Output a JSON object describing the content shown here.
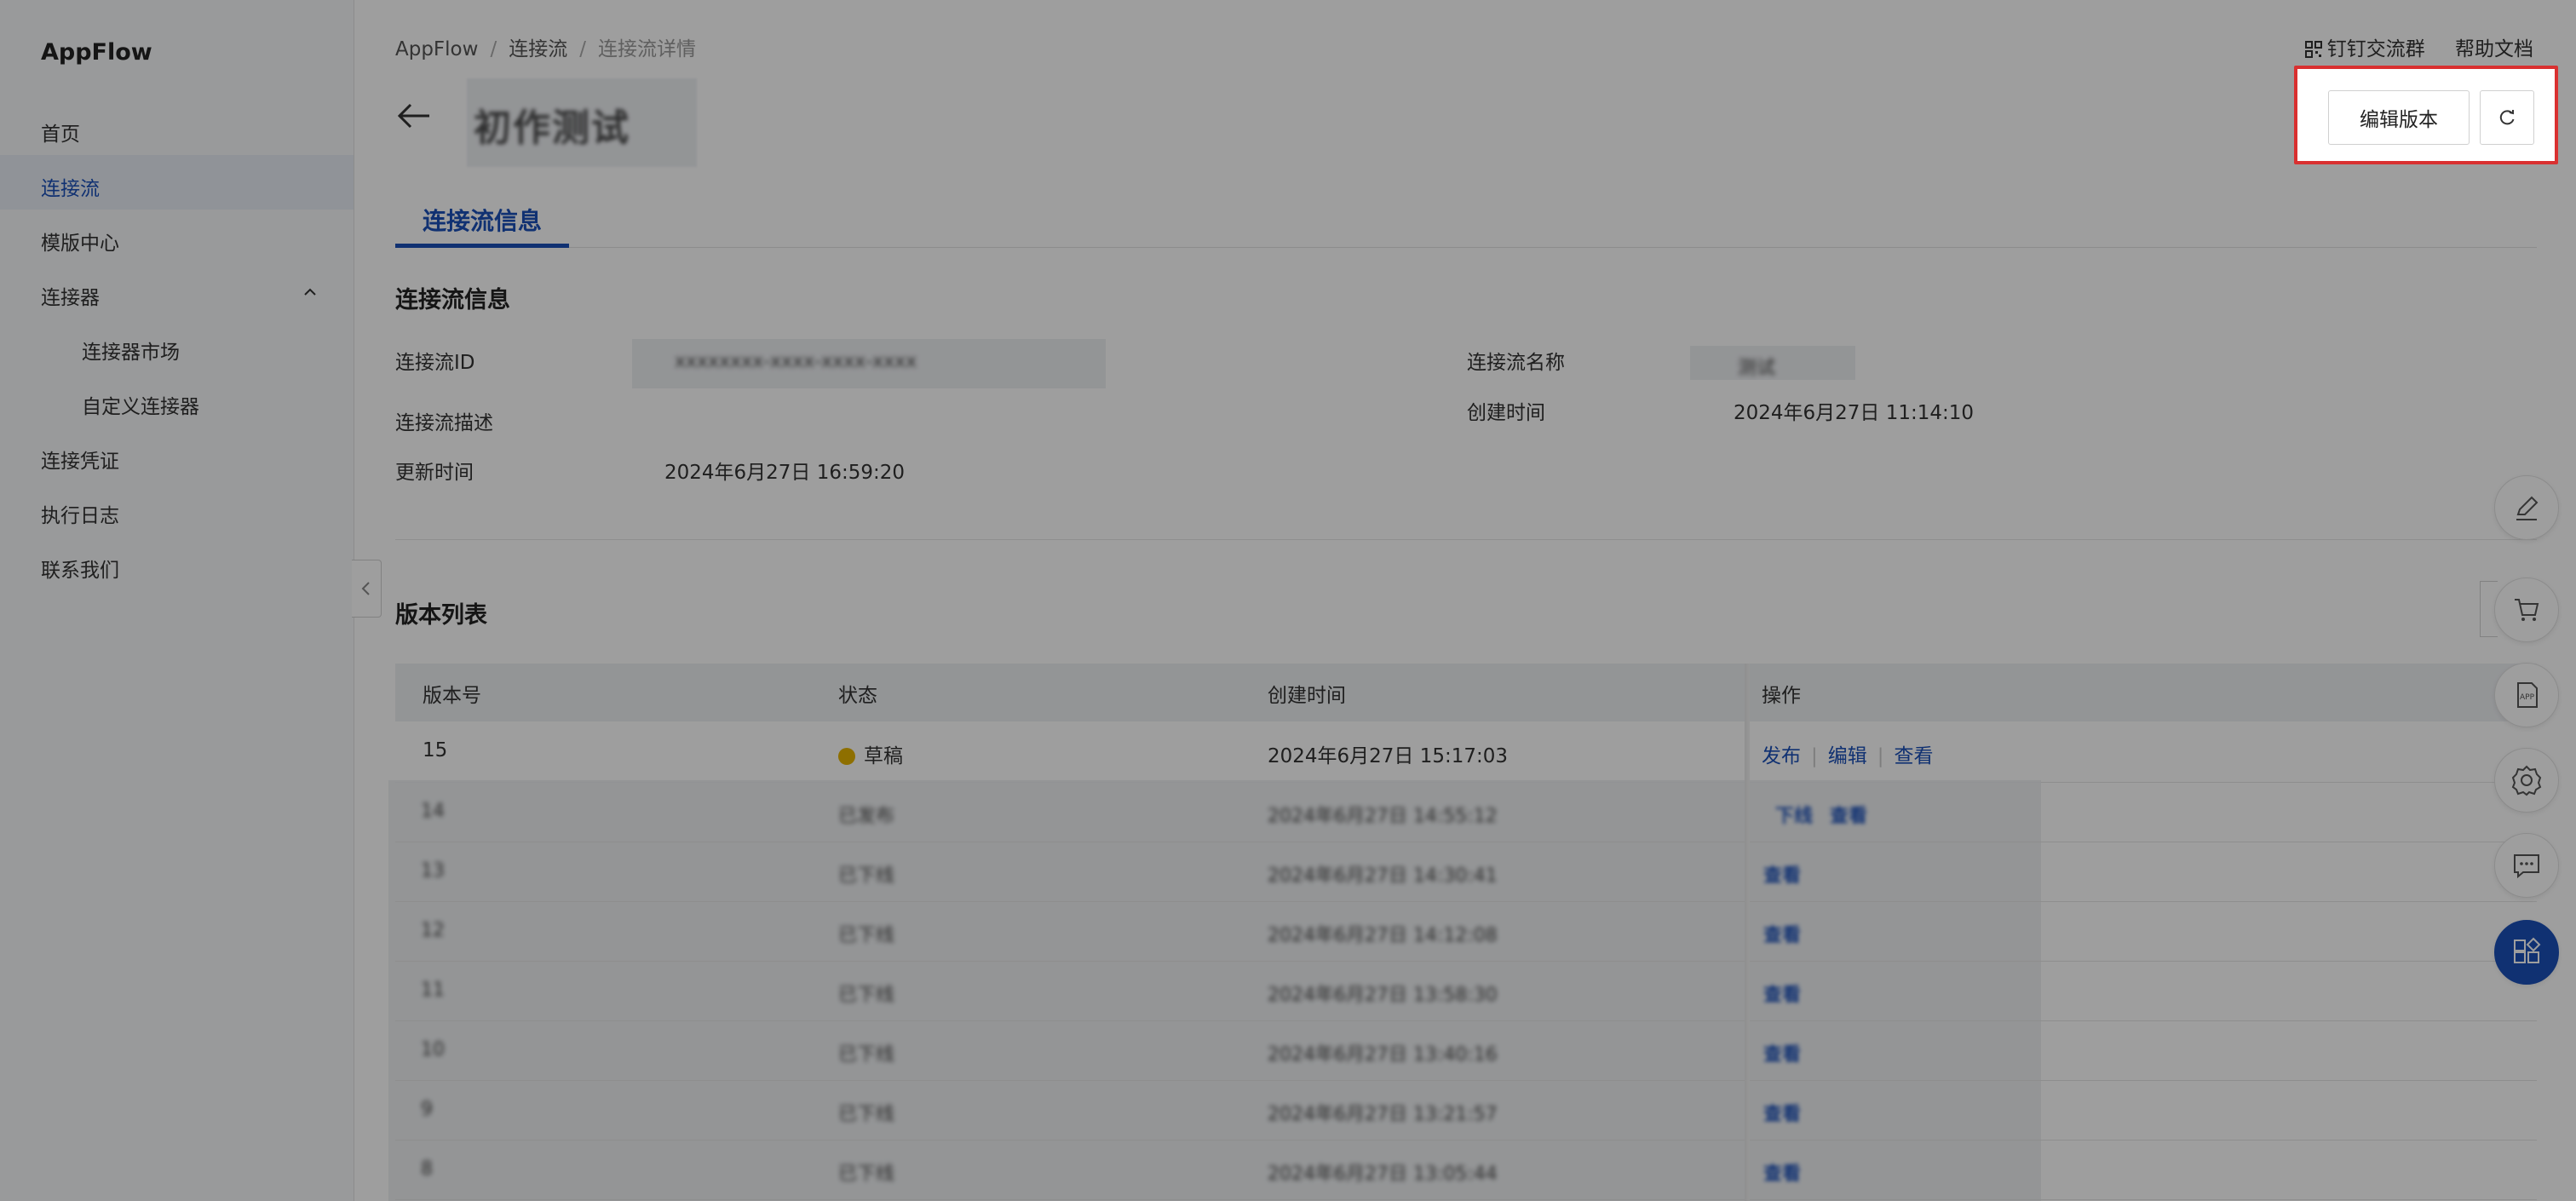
{
  "sidebar": {
    "brand": "AppFlow",
    "items": [
      {
        "label": "首页"
      },
      {
        "label": "连接流"
      },
      {
        "label": "模版中心"
      },
      {
        "label": "连接器"
      },
      {
        "label": "连接器市场"
      },
      {
        "label": "自定义连接器"
      },
      {
        "label": "连接凭证"
      },
      {
        "label": "执行日志"
      },
      {
        "label": "联系我们"
      }
    ],
    "active_index": 1
  },
  "header": {
    "breadcrumb": [
      "AppFlow",
      "连接流",
      "连接流详情"
    ],
    "links": [
      "钉钉交流群",
      "帮助文档"
    ],
    "title": "初作测试",
    "edit_version_label": "编辑版本"
  },
  "tabs": [
    {
      "label": "连接流信息"
    }
  ],
  "info": {
    "section_title": "连接流信息",
    "id_label": "连接流ID",
    "id_value": "xxxxxxxx-xxxx-xxxx-xxxx",
    "name_label": "连接流名称",
    "name_value": "测试",
    "desc_label": "连接流描述",
    "created_label": "创建时间",
    "created_value": "2024年6月27日 11:14:10",
    "updated_label": "更新时间",
    "updated_value": "2024年6月27日 16:59:20"
  },
  "versions": {
    "section_title": "版本列表",
    "columns": [
      "版本号",
      "状态",
      "创建时间",
      "操作"
    ],
    "rows": [
      {
        "version": "15",
        "status": "草稿",
        "status_color": "#e5b400",
        "created": "2024年6月27日 15:17:03",
        "actions": [
          "发布",
          "编辑",
          "查看"
        ]
      }
    ],
    "blurred_rows": [
      {
        "version": "14",
        "status": "已发布",
        "created": "2024年6月27日 14:55:12",
        "actions": [
          "下线",
          "查看"
        ]
      },
      {
        "version": "13",
        "status": "已下线",
        "created": "2024年6月27日 14:30:41",
        "actions": [
          "查看"
        ]
      },
      {
        "version": "12",
        "status": "已下线",
        "created": "2024年6月27日 14:12:08",
        "actions": [
          "查看"
        ]
      },
      {
        "version": "11",
        "status": "已下线",
        "created": "2024年6月27日 13:58:30",
        "actions": [
          "查看"
        ]
      },
      {
        "version": "10",
        "status": "已下线",
        "created": "2024年6月27日 13:40:16",
        "actions": [
          "查看"
        ]
      },
      {
        "version": "9",
        "status": "已下线",
        "created": "2024年6月27日 13:21:57",
        "actions": [
          "查看"
        ]
      },
      {
        "version": "8",
        "status": "已下线",
        "created": "2024年6月27日 13:05:44",
        "actions": [
          "查看"
        ]
      }
    ]
  },
  "float_tools": [
    "edit-icon",
    "cart-icon",
    "app-icon",
    "settings-icon",
    "chat-icon",
    "grid-icon"
  ],
  "colors": {
    "accent": "#1a4fb8",
    "draft": "#e5b400",
    "published": "#3aa33a",
    "highlight": "#d93030"
  }
}
